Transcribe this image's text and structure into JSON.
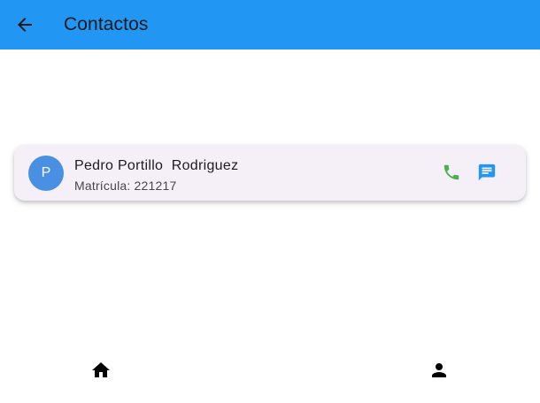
{
  "appbar": {
    "title": "Contactos",
    "back_icon": "arrow-back-icon",
    "color": "#2196F3"
  },
  "contacts": [
    {
      "avatar_letter": "P",
      "avatar_color": "#4a90e2",
      "name": "Pedro Portillo  Rodriguez",
      "subtitle": "Matrícula: 221217",
      "call_icon": "phone-icon",
      "call_color": "#4CAF50",
      "message_icon": "message-icon",
      "message_color": "#2196F3"
    }
  ],
  "bottom_nav": {
    "items": [
      {
        "icon": "home-icon"
      },
      {
        "icon": "person-icon"
      }
    ]
  }
}
